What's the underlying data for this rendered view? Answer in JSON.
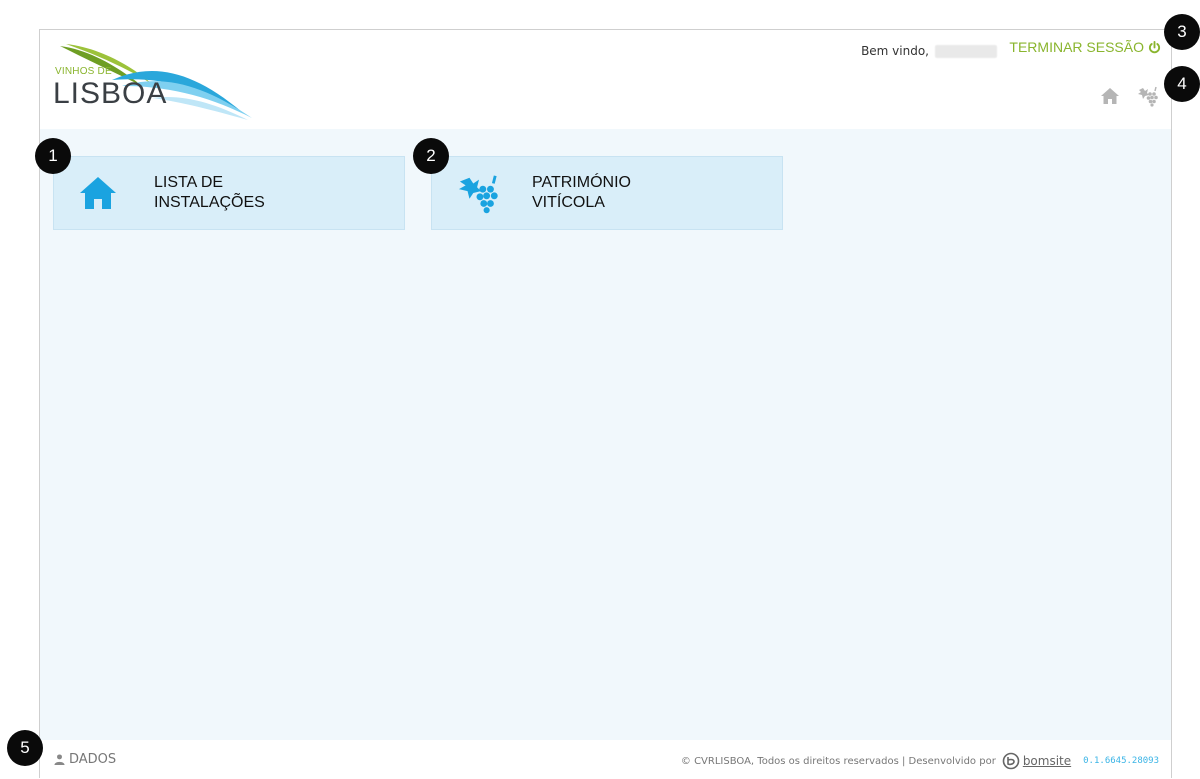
{
  "header": {
    "logo": {
      "small_text": "VINHOS DE",
      "big_text": "LISBOA"
    },
    "welcome_text": "Bem vindo,",
    "logout_label": "TERMINAR SESSÃO",
    "nav_icons": [
      "home-icon",
      "grapes-icon"
    ]
  },
  "tiles": [
    {
      "label": "LISTA DE\nINSTALAÇÕES",
      "icon": "home-icon"
    },
    {
      "label": "PATRIMÓNIO\nVITÍCOLA",
      "icon": "grapes-icon"
    }
  ],
  "footer": {
    "dados_label": "DADOS",
    "copyright": "© CVRLISBOA, Todos os direitos reservados | Desenvolvido por",
    "developer": "bomsite",
    "version": "0.1.6645.28093"
  },
  "markers": [
    "1",
    "2",
    "3",
    "4",
    "5"
  ],
  "colors": {
    "accent_green": "#8ab52e",
    "accent_blue": "#1aa3e0",
    "tile_bg": "#d9eef9",
    "main_bg": "#f1f8fc"
  }
}
